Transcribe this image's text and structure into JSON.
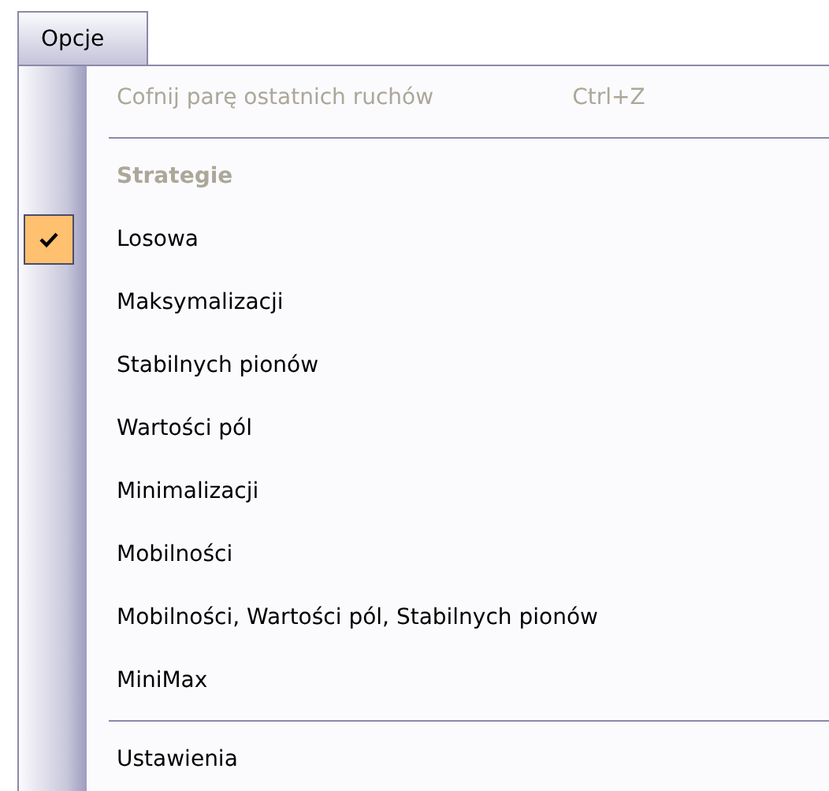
{
  "menu": {
    "title": "Opcje",
    "selected": true
  },
  "items": [
    {
      "kind": "command",
      "label": "Cofnij parę ostatnich ruchów",
      "shortcut": "Ctrl+Z",
      "disabled": true
    },
    {
      "kind": "separator"
    },
    {
      "kind": "header",
      "label": "Strategie"
    },
    {
      "kind": "option",
      "label": "Losowa",
      "checked": true
    },
    {
      "kind": "option",
      "label": "Maksymalizacji",
      "checked": false
    },
    {
      "kind": "option",
      "label": "Stabilnych pionów",
      "checked": false
    },
    {
      "kind": "option",
      "label": "Wartości pól",
      "checked": false
    },
    {
      "kind": "option",
      "label": "Minimalizacji",
      "checked": false
    },
    {
      "kind": "option",
      "label": "Mobilności",
      "checked": false
    },
    {
      "kind": "option",
      "label": "Mobilności, Wartości pól, Stabilnych pionów",
      "checked": false
    },
    {
      "kind": "option",
      "label": "MiniMax",
      "checked": false
    },
    {
      "kind": "separator"
    },
    {
      "kind": "command",
      "label": "Ustawienia",
      "disabled": false
    }
  ]
}
